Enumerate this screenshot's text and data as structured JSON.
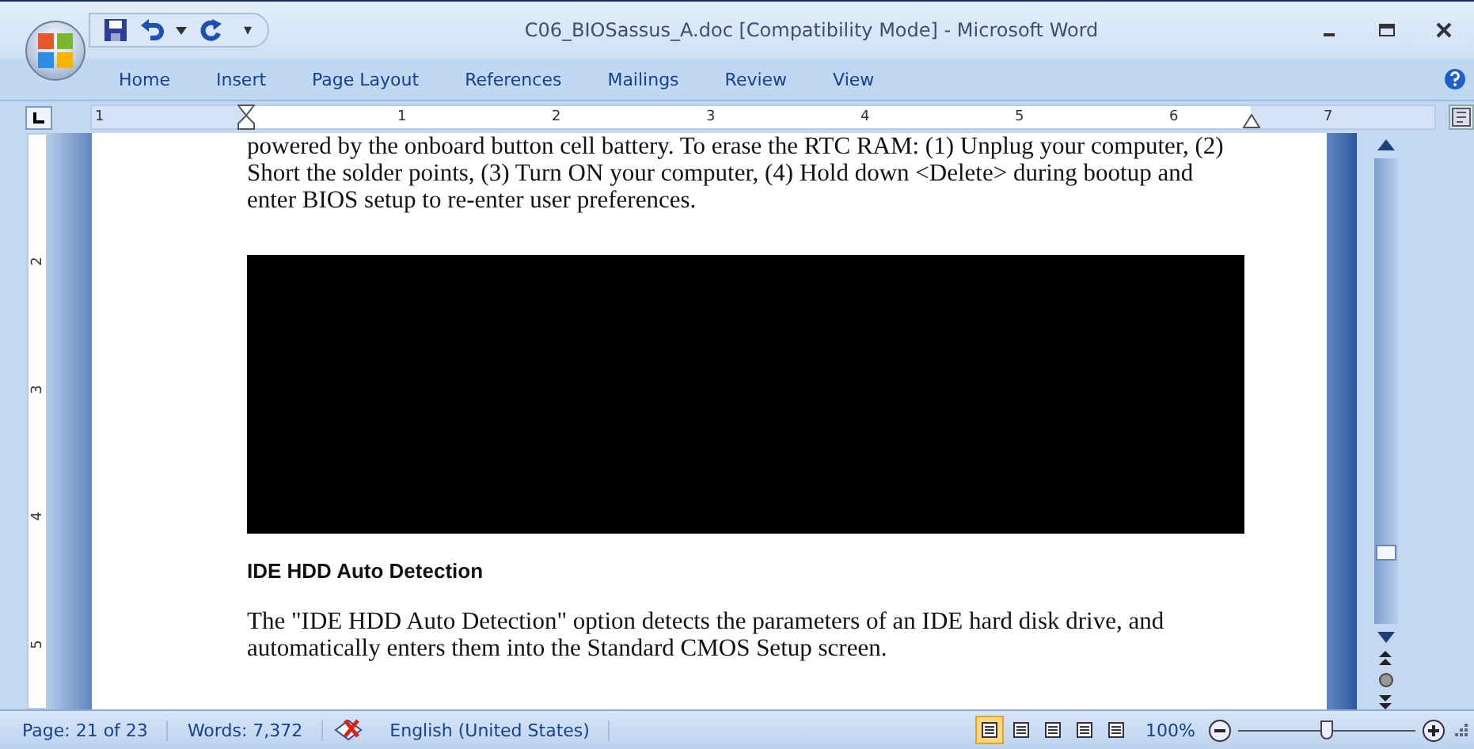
{
  "window": {
    "title": "C06_BIOSassus_A.doc [Compatibility Mode] - Microsoft Word"
  },
  "quick_access": [
    "▾"
  ],
  "tabs": [
    {
      "label": "Home",
      "selected": false
    },
    {
      "label": "Insert",
      "selected": false
    },
    {
      "label": "Page Layout",
      "selected": false
    },
    {
      "label": "References",
      "selected": false
    },
    {
      "label": "Mailings",
      "selected": false
    },
    {
      "label": "Review",
      "selected": false
    },
    {
      "label": "View",
      "selected": false
    }
  ],
  "ruler": {
    "numbers": [
      "1",
      "1",
      "2",
      "3",
      "4",
      "5",
      "6",
      "7"
    ]
  },
  "vertical_ruler": {
    "numbers": [
      "2",
      "3",
      "4",
      "5"
    ]
  },
  "document": {
    "paragraphs": [
      {
        "kind": "body",
        "text": "powered by the onboard button cell battery. To erase the RTC RAM: (1) Unplug your computer, (2) Short the solder points, (3) Turn ON your computer, (4) Hold down <Delete> during bootup and enter BIOS setup to re-enter user preferences."
      },
      {
        "kind": "image"
      },
      {
        "kind": "heading",
        "text": "IDE HDD Auto Detection"
      },
      {
        "kind": "body",
        "text": "The \"IDE HDD Auto Detection\" option detects the parameters  of an IDE hard disk drive, and automatically enters them into the Standard CMOS Setup screen."
      }
    ]
  },
  "status_bar": {
    "page": "Page: 21 of 23",
    "words": "Words: 7,372",
    "language": "English (United States)",
    "views": [
      {
        "selected": true
      },
      {
        "selected": false
      },
      {
        "selected": false
      },
      {
        "selected": false
      },
      {
        "selected": false
      }
    ],
    "zoom": "100%",
    "zoom_slider": {
      "level": 0.5
    }
  }
}
